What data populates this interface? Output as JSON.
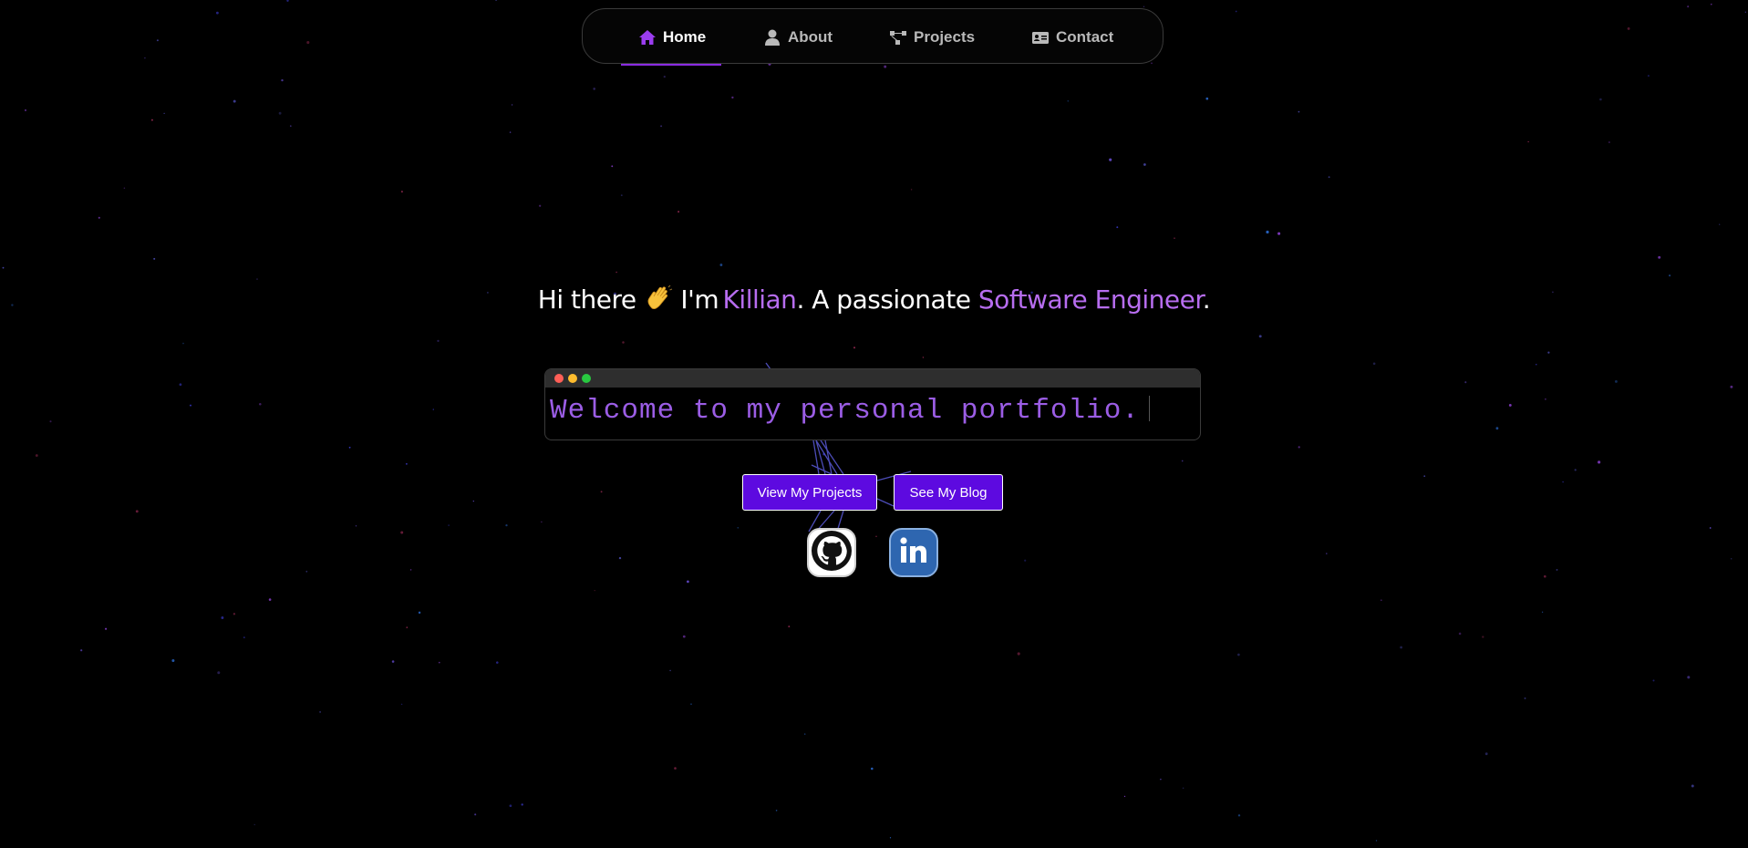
{
  "nav": {
    "items": [
      {
        "label": "Home",
        "icon": "home-icon",
        "active": true
      },
      {
        "label": "About",
        "icon": "user-icon",
        "active": false
      },
      {
        "label": "Projects",
        "icon": "project-diagram-icon",
        "active": false
      },
      {
        "label": "Contact",
        "icon": "id-card-icon",
        "active": false
      }
    ]
  },
  "hero": {
    "greeting": "Hi there",
    "wave_icon": "waving-hand-icon",
    "im": "I'm",
    "name": "Killian",
    "middle": ". A passionate",
    "role": "Software Engineer",
    "end": "."
  },
  "terminal": {
    "text": "Welcome to my personal portfolio."
  },
  "buttons": {
    "projects": "View My Projects",
    "blog": "See My Blog"
  },
  "social": {
    "github_icon": "github-icon",
    "linkedin_icon": "linkedin-icon"
  },
  "colors": {
    "accent": "#b76df0",
    "button": "#5d0ae0",
    "background": "#000000",
    "terminal_text": "#9b5de5"
  }
}
